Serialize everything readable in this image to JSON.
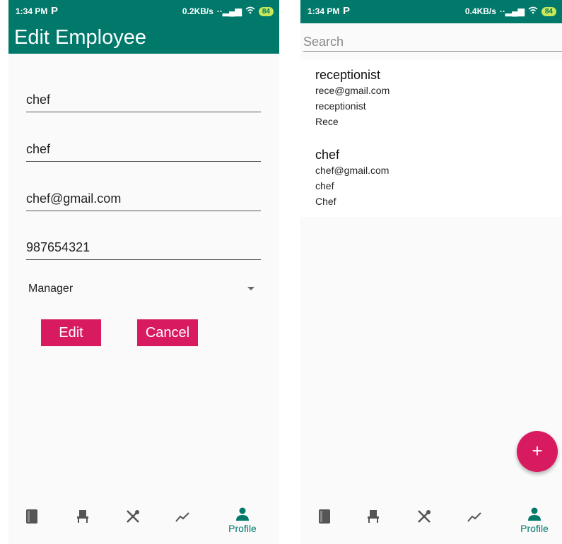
{
  "left_screen": {
    "status": {
      "time": "1:34 PM",
      "app_icon": "P",
      "net": "0.2KB/s",
      "signal": "··▂▄▆",
      "battery": "84"
    },
    "title": "Edit Employee",
    "fields": [
      "chef",
      "chef",
      "chef@gmail.com",
      "987654321"
    ],
    "role": {
      "selected": "Manager"
    },
    "edit_label": "Edit",
    "cancel_label": "Cancel",
    "nav": {
      "active": "Profile",
      "profile_label": "Profile",
      "icons": [
        "book-icon",
        "chair-icon",
        "utensils-icon",
        "chart-icon",
        "person-icon"
      ]
    }
  },
  "right_screen": {
    "status": {
      "time": "1:34 PM",
      "app_icon": "P",
      "net": "0.4KB/s",
      "signal": "··▂▄▆",
      "battery": "84"
    },
    "search": {
      "placeholder": "Search"
    },
    "employees": [
      {
        "name": "receptionist",
        "email": "rece@gmail.com",
        "role": "receptionist",
        "extra": "Rece"
      },
      {
        "name": "chef",
        "email": "chef@gmail.com",
        "role": "chef",
        "extra": "Chef"
      }
    ],
    "fab_label": "+",
    "nav": {
      "active": "Profile",
      "profile_label": "Profile"
    }
  },
  "colors": {
    "primary": "#00796b",
    "accent": "#d81b60",
    "background": "#fafafa"
  }
}
